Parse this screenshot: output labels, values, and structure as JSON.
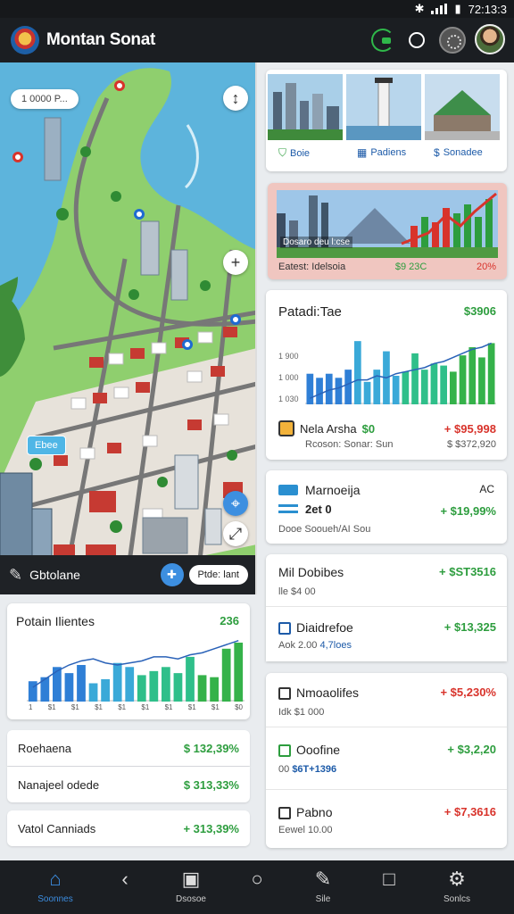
{
  "status": {
    "time": "72:13:3"
  },
  "app": {
    "title": "Montan Sonat"
  },
  "map": {
    "chip": "1 0000 P...",
    "tag": "Ebee",
    "bar_label": "Gbtolane",
    "bar_pill": "Ptde: lant"
  },
  "photos": [
    {
      "label": "Boie"
    },
    {
      "label": "Padiens"
    },
    {
      "label": "Sonadee"
    }
  ],
  "banner": {
    "overlay": "Dosaro deu l:cse",
    "foot_left": "Eatest: Idelsoia",
    "foot_mid": "$9 23C",
    "foot_right": "20%"
  },
  "metrics": {
    "title": "Patadi:Tae",
    "value": "$3906",
    "yticks": [
      "1 900",
      "1 000",
      "1 030"
    ],
    "row1_name": "Nela  Arsha",
    "row1_num": "$0",
    "row1_val": "+ $95,998",
    "row2_left": "Rcoson: Sonar: Sun",
    "row2_val": "$ $372,920"
  },
  "cards": [
    {
      "title": "Marnoeija",
      "corner": "AC",
      "sub": "2et 0",
      "sub2": "Dooe  Sooueh/AI Sou",
      "val": "+ $19,99%"
    },
    {
      "title": "Mil Dobibes",
      "sub": "lle $4 00",
      "val": "+ $ST3516"
    },
    {
      "title": "Diaidrefoe",
      "sub": "Aok 2.00",
      "sub_b": "4,7loes",
      "val": "+ $13,325"
    },
    {
      "title": "Nmoaolifes",
      "sub": "Idk $1 000",
      "val": "+ $5,230%"
    },
    {
      "title": "Ooofine",
      "sub": "00",
      "sub_b": "$6T+1396",
      "val": "+ $3,2,20"
    },
    {
      "title": "Pabno",
      "sub": "Eewel 10.00",
      "val": "+ $7,3616"
    }
  ],
  "left_chart": {
    "title": "Potain Ilientes",
    "value": "236",
    "ticks": [
      "1",
      "$1",
      "$1",
      "$1",
      "$1",
      "$1",
      "$1",
      "$1",
      "$1",
      "$0"
    ]
  },
  "left_rows": [
    {
      "label": "Roehaena",
      "value": "$ 132,39%"
    },
    {
      "label": "Nanajeel odede",
      "value": "$ 313,33%"
    },
    {
      "label": "Vatol Canniads",
      "value": "+ 313,39%"
    }
  ],
  "nav": [
    {
      "label": "Soonnes",
      "icon": "home-icon"
    },
    {
      "label": "",
      "icon": "back-icon"
    },
    {
      "label": "Dsosoe",
      "icon": "wallet-icon"
    },
    {
      "label": "",
      "icon": "circle-icon"
    },
    {
      "label": "Sile",
      "icon": "edit-icon"
    },
    {
      "label": "",
      "icon": "square-icon"
    },
    {
      "label": "Sonlcs",
      "icon": "settings-icon"
    }
  ],
  "chart_data": [
    {
      "type": "bar",
      "title": "Patadi:Tae",
      "values": [
        30,
        26,
        30,
        26,
        34,
        62,
        22,
        34,
        52,
        28,
        32,
        50,
        34,
        40,
        38,
        32,
        48,
        56,
        46,
        60
      ],
      "trend": [
        6,
        10,
        14,
        16,
        20,
        24,
        24,
        28,
        26,
        30,
        32,
        34,
        36,
        40,
        42,
        46,
        50,
        54,
        56,
        60
      ],
      "ylim": [
        0,
        70
      ]
    },
    {
      "type": "bar",
      "title": "Potain Ilientes",
      "values": [
        20,
        24,
        34,
        28,
        36,
        18,
        22,
        38,
        34,
        26,
        30,
        34,
        28,
        44,
        26,
        24,
        52,
        58
      ],
      "trend": [
        14,
        22,
        30,
        36,
        40,
        42,
        38,
        36,
        38,
        40,
        44,
        44,
        42,
        46,
        48,
        52,
        56,
        60
      ],
      "ylim": [
        0,
        65
      ]
    }
  ]
}
